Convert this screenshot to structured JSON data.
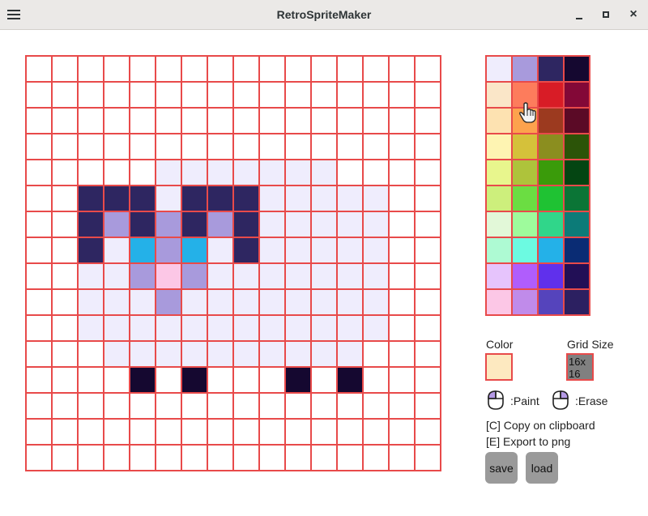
{
  "window": {
    "title": "RetroSpriteMaker"
  },
  "palette_colors": [
    "#efedfd",
    "#a89adc",
    "#2e2661",
    "#150830",
    "#fae6c8",
    "#fd7c5c",
    "#d81c26",
    "#830837",
    "#fde2b1",
    "#fda24d",
    "#9c3a1f",
    "#5b0a26",
    "#fef4b2",
    "#d5c13a",
    "#8b8e1f",
    "#2c5408",
    "#e8f68d",
    "#aec33b",
    "#3a9b0a",
    "#044512",
    "#cdef7c",
    "#6bdd42",
    "#1fc233",
    "#0b7536",
    "#e2f8d8",
    "#9efb9c",
    "#30d68a",
    "#0c7b78",
    "#aefad3",
    "#6cfae1",
    "#24b1e8",
    "#0a2c74",
    "#e6c4fc",
    "#b05dfc",
    "#6030ec",
    "#220f56",
    "#fcc7e6",
    "#c08bea",
    "#5544bc",
    "#2c2061"
  ],
  "sprite": {
    "grid_size": 16,
    "pixels": [
      [
        0,
        0,
        0,
        0,
        0,
        0,
        0,
        0,
        0,
        0,
        0,
        0,
        0,
        0,
        0,
        0
      ],
      [
        0,
        0,
        0,
        0,
        0,
        0,
        0,
        0,
        0,
        0,
        0,
        0,
        0,
        0,
        0,
        0
      ],
      [
        0,
        0,
        0,
        0,
        0,
        0,
        0,
        0,
        0,
        0,
        0,
        0,
        0,
        0,
        0,
        0
      ],
      [
        0,
        0,
        0,
        0,
        0,
        0,
        0,
        0,
        0,
        0,
        0,
        0,
        0,
        0,
        0,
        0
      ],
      [
        0,
        0,
        0,
        0,
        0,
        1,
        1,
        1,
        1,
        1,
        1,
        1,
        0,
        0,
        0,
        0
      ],
      [
        0,
        0,
        2,
        2,
        2,
        1,
        2,
        2,
        2,
        1,
        1,
        1,
        1,
        1,
        0,
        0
      ],
      [
        0,
        0,
        2,
        3,
        2,
        3,
        2,
        3,
        2,
        1,
        1,
        1,
        1,
        1,
        0,
        0
      ],
      [
        0,
        0,
        2,
        1,
        4,
        3,
        4,
        1,
        2,
        1,
        1,
        1,
        1,
        1,
        0,
        0
      ],
      [
        0,
        0,
        1,
        1,
        3,
        5,
        3,
        1,
        1,
        1,
        1,
        1,
        1,
        1,
        0,
        0
      ],
      [
        0,
        0,
        1,
        1,
        1,
        3,
        1,
        1,
        1,
        1,
        1,
        1,
        1,
        1,
        0,
        0
      ],
      [
        0,
        0,
        1,
        1,
        1,
        1,
        1,
        1,
        1,
        1,
        1,
        1,
        1,
        1,
        0,
        0
      ],
      [
        0,
        0,
        0,
        1,
        1,
        1,
        1,
        1,
        1,
        1,
        1,
        1,
        1,
        0,
        0,
        0
      ],
      [
        0,
        0,
        0,
        0,
        6,
        0,
        6,
        0,
        0,
        0,
        6,
        0,
        6,
        0,
        0,
        0
      ],
      [
        0,
        0,
        0,
        0,
        0,
        0,
        0,
        0,
        0,
        0,
        0,
        0,
        0,
        0,
        0,
        0
      ],
      [
        0,
        0,
        0,
        0,
        0,
        0,
        0,
        0,
        0,
        0,
        0,
        0,
        0,
        0,
        0,
        0
      ],
      [
        0,
        0,
        0,
        0,
        0,
        0,
        0,
        0,
        0,
        0,
        0,
        0,
        0,
        0,
        0,
        0
      ]
    ],
    "pixel_colors": [
      "#ffffff",
      "#efedfd",
      "#2e2661",
      "#a89adc",
      "#24b1e8",
      "#fcc7e6",
      "#150830"
    ]
  },
  "current_color": {
    "label": "Color",
    "value": "#fde9c0"
  },
  "grid_size": {
    "label": "Grid Size",
    "value": "16x\n16"
  },
  "controls": {
    "paint": ":Paint",
    "erase": ":Erase",
    "copy": "[C] Copy on clipboard",
    "export": "[E] Export to png"
  },
  "buttons": {
    "save": "save",
    "load": "load"
  },
  "icons": {
    "menu": "hamburger-icon",
    "minimize": "minimize-icon",
    "maximize": "maximize-icon",
    "close": "close-icon",
    "paint_mouse": "mouse-left-click-icon",
    "erase_mouse": "mouse-right-click-icon",
    "cursor": "hand-pointer-icon"
  }
}
